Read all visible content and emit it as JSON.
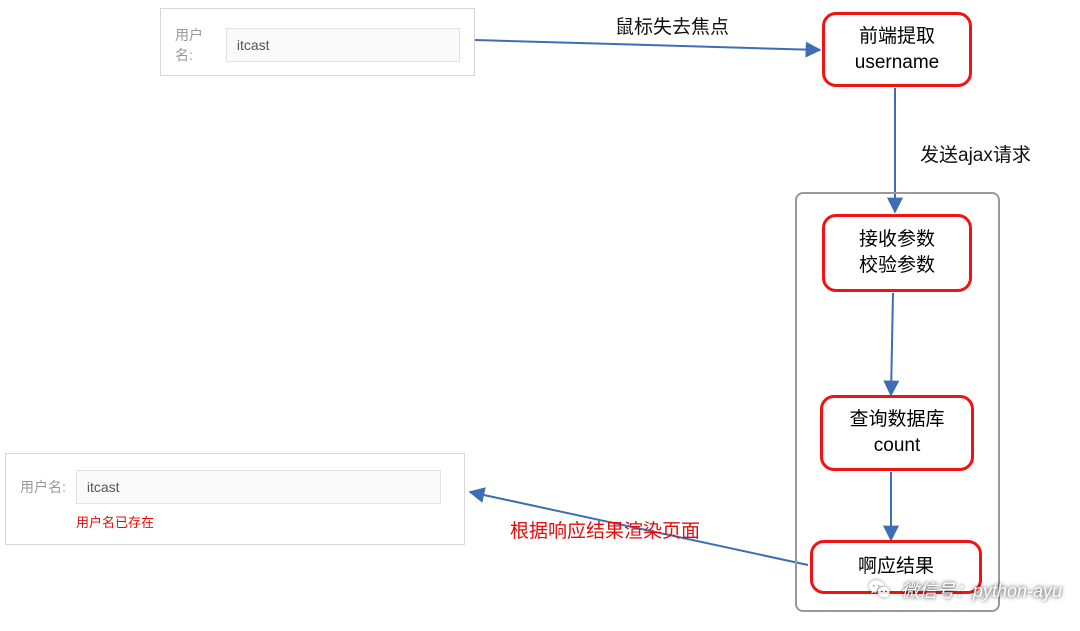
{
  "forms": {
    "top": {
      "label": "用户名:",
      "value": "itcast"
    },
    "bottom": {
      "label": "用户名:",
      "value": "itcast",
      "error": "用户名已存在"
    }
  },
  "nodes": {
    "frontend_extract": {
      "line1": "前端提取",
      "line2": "username"
    },
    "receive_validate": {
      "line1": "接收参数",
      "line2": "校验参数"
    },
    "query_db": {
      "line1": "查询数据库",
      "line2": "count"
    },
    "respond": {
      "line1": "啊应结果"
    }
  },
  "edges": {
    "blur": "鼠标失去焦点",
    "send_ajax": "发送ajax请求",
    "render_page": "根据响应结果渲染页面"
  },
  "watermark": "微信号：python-ayu"
}
